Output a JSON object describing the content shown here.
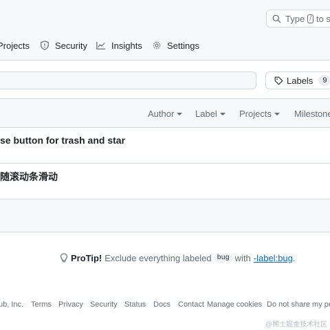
{
  "header": {
    "search": {
      "prefix": "Type",
      "key": "/",
      "suffix": "to sea"
    },
    "tabs": [
      {
        "label": "Projects",
        "icon": "projects-icon"
      },
      {
        "label": "Security",
        "icon": "shield-icon"
      },
      {
        "label": "Insights",
        "icon": "graph-icon"
      },
      {
        "label": "Settings",
        "icon": "gear-icon"
      }
    ]
  },
  "filters": {
    "labels_button": {
      "label": "Labels",
      "count": "9"
    },
    "menus": [
      "Author",
      "Label",
      "Projects",
      "Milestones"
    ]
  },
  "issues": [
    {
      "title": "se button for trash and star"
    },
    {
      "title": "随滚动条滑动"
    }
  ],
  "protip": {
    "lead": "ProTip!",
    "text": "Exclude everything labeled",
    "code": "bug",
    "with": "with",
    "link": "-label:bug",
    "end": "."
  },
  "footer": {
    "items": [
      "ub, Inc.",
      "Terms",
      "Privacy",
      "Security",
      "Status",
      "Docs",
      "Contact",
      "Manage cookies",
      "Do not share my per"
    ]
  },
  "watermark": "@稀土掘金技术社区",
  "colors": {
    "link": "#0969da",
    "border": "#d0d7de",
    "muted": "#656d76",
    "subtle_bg": "#f6f8fa"
  }
}
